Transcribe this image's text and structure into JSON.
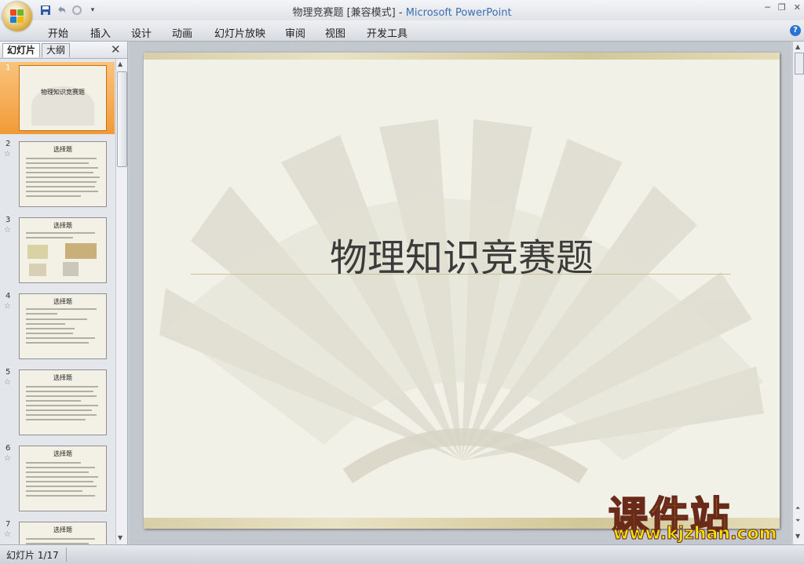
{
  "window": {
    "title": "物理竞赛题 [兼容模式]",
    "app": "Microsoft PowerPoint",
    "title_sep": " - "
  },
  "qat": {
    "save_icon": "save-icon",
    "undo_icon": "undo-icon",
    "redo_icon": "redo-icon"
  },
  "ribbon": {
    "tabs": [
      "开始",
      "插入",
      "设计",
      "动画",
      "幻灯片放映",
      "审阅",
      "视图",
      "开发工具"
    ],
    "help": "?"
  },
  "pane": {
    "tab_slides": "幻灯片",
    "tab_outline": "大纲",
    "close": "✕"
  },
  "thumbnails": [
    {
      "num": "1",
      "title": "物理知识竞赛题",
      "star": ""
    },
    {
      "num": "2",
      "title": "选择题",
      "star": "☆"
    },
    {
      "num": "3",
      "title": "选择题",
      "star": "☆"
    },
    {
      "num": "4",
      "title": "选择题",
      "star": "☆"
    },
    {
      "num": "5",
      "title": "选择题",
      "star": "☆"
    },
    {
      "num": "6",
      "title": "选择题",
      "star": "☆"
    },
    {
      "num": "7",
      "title": "选择题",
      "star": "☆"
    }
  ],
  "slide": {
    "title": "物理知识竞赛题"
  },
  "watermark": {
    "brand": "课件站",
    "url": "www.kjzhan.com"
  },
  "status": {
    "slide_info": "幻灯片 1/17"
  },
  "colors": {
    "accent": "#3a6fb3",
    "selection": "#f29a36",
    "watermark": "#f5e400"
  }
}
